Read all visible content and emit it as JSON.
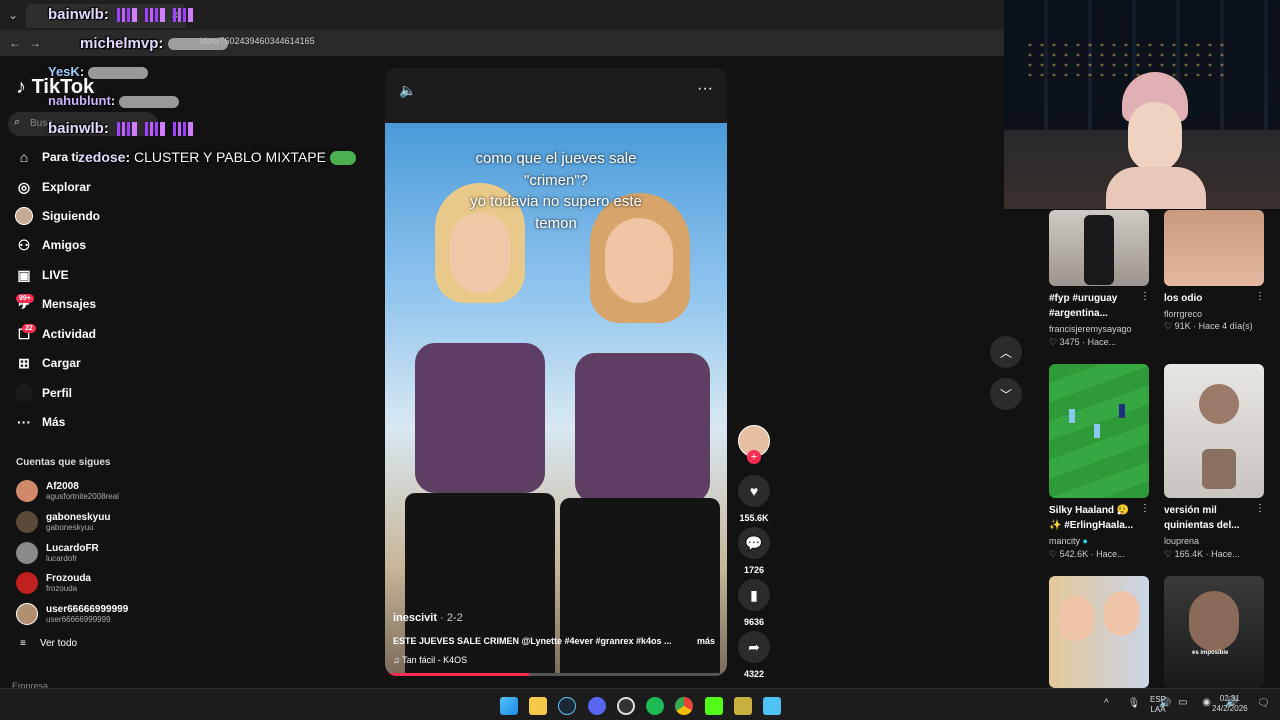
{
  "browser": {
    "url": "ideo/7602439460344614165"
  },
  "chat": [
    {
      "user": "bainwlb",
      "text": ""
    },
    {
      "user": "michelmvp",
      "text": ""
    },
    {
      "user": "YesK",
      "text": ""
    },
    {
      "user": "nahublunt",
      "text": ""
    },
    {
      "user": "bainwlb",
      "text": ""
    },
    {
      "user": "zedose",
      "text": "CLUSTER Y PABLO MIXTAPE"
    }
  ],
  "sidebar": {
    "logo": "TikTok",
    "search_placeholder": "Busc",
    "nav": [
      {
        "label": "Para ti",
        "icon": "home-icon"
      },
      {
        "label": "Explorar",
        "icon": "compass-icon"
      },
      {
        "label": "Siguiendo",
        "icon": "following-avatar-icon"
      },
      {
        "label": "Amigos",
        "icon": "friends-icon"
      },
      {
        "label": "LIVE",
        "icon": "live-icon"
      },
      {
        "label": "Mensajes",
        "icon": "messages-icon",
        "badge": "99+"
      },
      {
        "label": "Actividad",
        "icon": "activity-icon",
        "badge": "22"
      },
      {
        "label": "Cargar",
        "icon": "upload-icon"
      },
      {
        "label": "Perfil",
        "icon": "profile-icon"
      },
      {
        "label": "Más",
        "icon": "more-icon"
      }
    ],
    "following_header": "Cuentas que sigues",
    "accounts": [
      {
        "name": "Af2008",
        "handle": "agusfortnite2008real"
      },
      {
        "name": "gaboneskyuu",
        "handle": "gaboneskyuu"
      },
      {
        "name": "LucardoFR",
        "handle": "lucardofr"
      },
      {
        "name": "Frozouda",
        "handle": "frozouda"
      },
      {
        "name": "user66666999999",
        "handle": "user66666999999"
      }
    ],
    "see_all": "Ver todo",
    "footer": "Empresa"
  },
  "video": {
    "caption_lines": [
      "como que el jueves sale",
      "\"crimen\"?",
      "yo todavia no supero este",
      "temon"
    ],
    "author": "inescivit",
    "date": "· 2-2",
    "description": "ESTE JUEVES SALE CRIMEN @Lynette #4ever #granrex #k4os ...",
    "more": "más",
    "sound": "Tan fácil - K4OS",
    "progress": 0.42
  },
  "actions": {
    "likes": "155.6K",
    "comments": "1726",
    "saves": "9636",
    "shares": "4322"
  },
  "grid": [
    {
      "caption": [
        "#fyp #uruguay",
        "#argentina..."
      ],
      "user": "francisjeremysayago",
      "likes": "3475",
      "time": "· Hace..."
    },
    {
      "caption": [
        "los odio"
      ],
      "user": "florrgreco",
      "likes": "91K",
      "time": "· Hace 4 día(s)"
    },
    {
      "caption": [
        "Silky Haaland 😮‍💨",
        "✨ #ErlingHaala..."
      ],
      "user": "mancity",
      "likes": "542.6K",
      "time": "· Hace..."
    },
    {
      "caption": [
        "versión mil",
        "quinientas del..."
      ],
      "user": "louprena",
      "likes": "165.4K",
      "time": "· Hace..."
    }
  ],
  "thumb_overlay": {
    "t4": "es imposible"
  },
  "taskbar": {
    "lang": "ESP",
    "layout": "LAA",
    "time": "02:31",
    "date": "24/2/2026"
  },
  "colors": {
    "accent": "#fe2c55",
    "bg": "#121212"
  }
}
